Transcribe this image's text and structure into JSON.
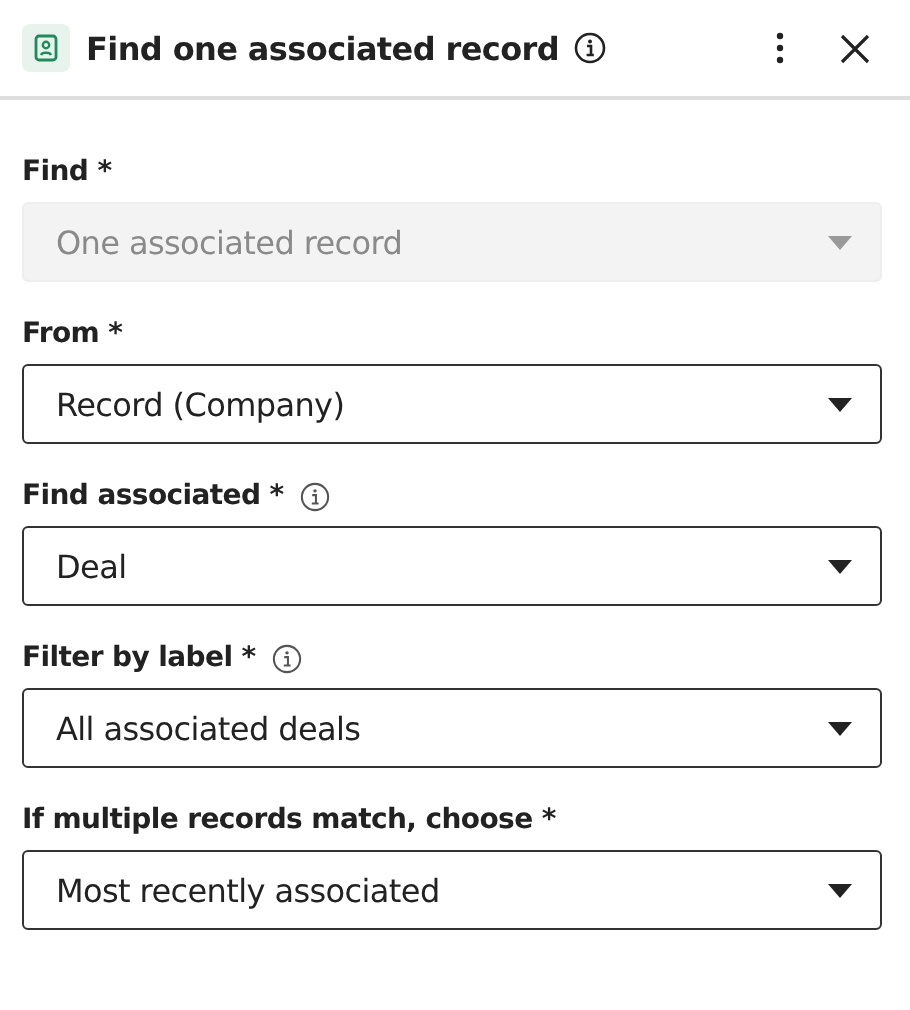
{
  "header": {
    "title": "Find one associated record"
  },
  "fields": [
    {
      "label": "Find *",
      "info": false,
      "value": "One associated record",
      "disabled": true
    },
    {
      "label": "From *",
      "info": false,
      "value": "Record (Company)",
      "disabled": false
    },
    {
      "label": "Find associated *",
      "info": true,
      "value": "Deal",
      "disabled": false
    },
    {
      "label": "Filter by label *",
      "info": true,
      "value": "All associated deals",
      "disabled": false
    },
    {
      "label": "If multiple records match, choose *",
      "info": false,
      "value": "Most recently associated",
      "disabled": false
    }
  ]
}
